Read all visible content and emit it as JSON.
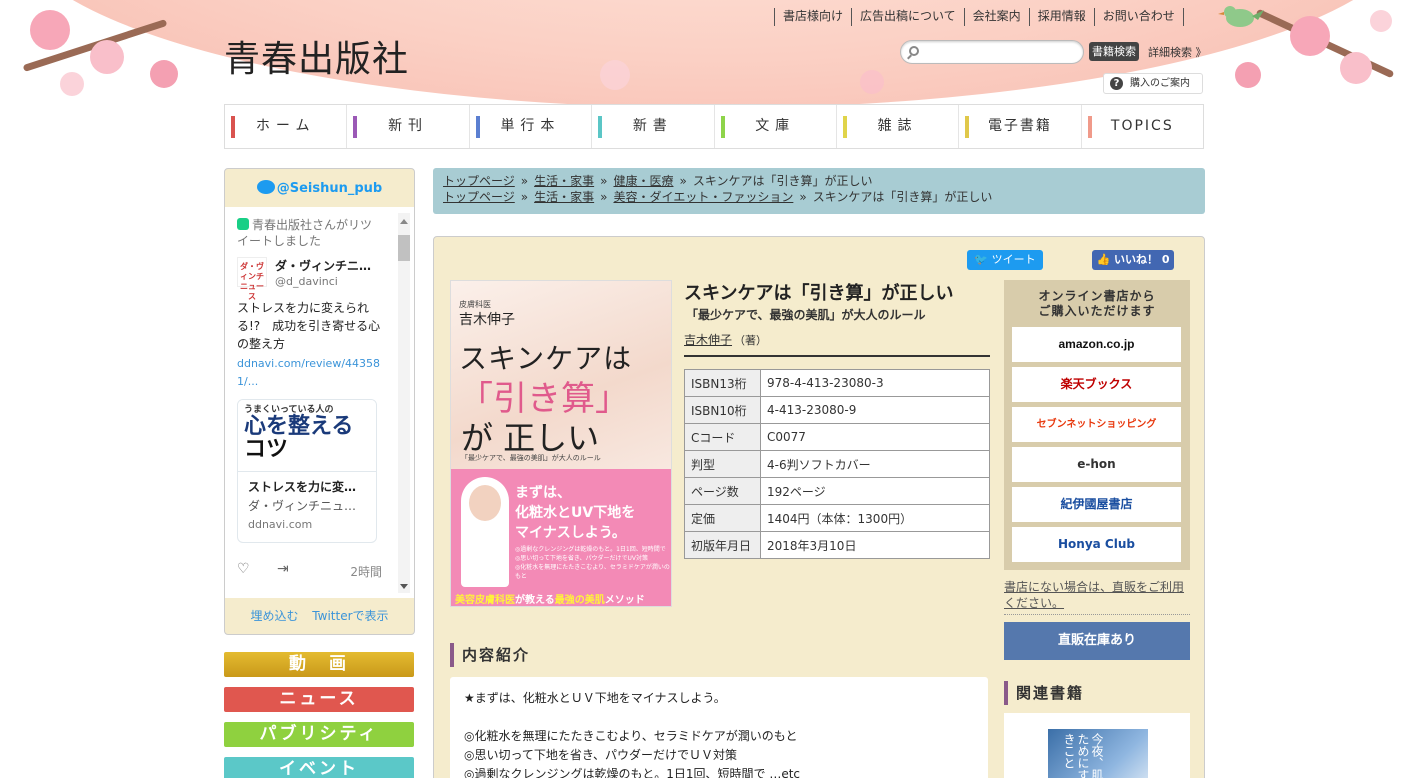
{
  "header": {
    "logo": "青春出版社",
    "top_links": [
      "書店様向け",
      "広告出稿について",
      "会社案内",
      "採用情報",
      "お問い合わせ"
    ],
    "search_placeholder": "",
    "search_button": "書籍検索",
    "advanced_search": "詳細検索 》",
    "purchase_guide": "購入のご案内"
  },
  "nav": {
    "items": [
      {
        "label": "ホーム",
        "color": "#d9534f"
      },
      {
        "label": "新刊",
        "color": "#9b59b6"
      },
      {
        "label": "単行本",
        "color": "#5b7fd1"
      },
      {
        "label": "新書",
        "color": "#5bc6c6"
      },
      {
        "label": "文庫",
        "color": "#8ed44a"
      },
      {
        "label": "雑誌",
        "color": "#e0d44a"
      },
      {
        "label": "電子書籍",
        "color": "#e0c84a"
      },
      {
        "label": "TOPICS",
        "color": "#f09a8a"
      }
    ]
  },
  "twitter": {
    "handle": "@Seishun_pub",
    "retweet_note": "青春出版社さんがリツイートしました",
    "avatar_text": "ダ・ヴィンチ ニュース",
    "name": "ダ・ヴィンチニ…",
    "user": "@d_davinci",
    "text": "ストレスを力に変えられる!?　成功を引き寄せる心の整え方",
    "link": "ddnavi.com/review/443581/...",
    "card_line1": "うまくいっている人の",
    "card_line2": "心を整える",
    "card_line3": "コツ",
    "card_title": "ストレスを力に変…",
    "card_sub": "ダ・ヴィンチニュ…",
    "card_domain": "ddnavi.com",
    "time": "2時間",
    "embed": "埋め込む",
    "view_on": "Twitterで表示"
  },
  "side_buttons": [
    {
      "label": "動　画",
      "color": "#d4a820"
    },
    {
      "label": "ニュース",
      "color": "#e0574f"
    },
    {
      "label": "パブリシティ",
      "color": "#8fd13f"
    },
    {
      "label": "イベント",
      "color": "#5bc8c8"
    }
  ],
  "breadcrumb": {
    "line1": [
      "トップページ",
      "生活・家事",
      "健康・医療"
    ],
    "line2": [
      "トップページ",
      "生活・家事",
      "美容・ダイエット・ファッション"
    ],
    "current": "スキンケアは「引き算」が正しい"
  },
  "share": {
    "tweet": "ツイート",
    "like": "いいね！ 0"
  },
  "cover": {
    "author_small": "皮膚科医",
    "author": "吉木伸子",
    "title1": "スキンケアは",
    "title2": "「引き算」",
    "title3": "が 正しい",
    "subtitle": "「最少ケアで、最強の美肌」が大人のルール",
    "msg1": "まずは、",
    "msg2": "化粧水とUV下地を",
    "msg3": "マイナスしよう。",
    "list1": "◎過剰なクレンジングは乾燥のもと。1日1回、短時間で",
    "list2": "◎思い切って下地を省き、パウダーだけでUV対策",
    "list3": "◎化粧水を無理にたたきこむより、セラミドケアが潤いのもと",
    "foot1": "美容皮膚科医",
    "foot2": "が教える",
    "foot3": "最強の美肌",
    "foot4": "メソッド"
  },
  "book": {
    "title": "スキンケアは「引き算」が正しい",
    "subtitle": "「最少ケアで、最強の美肌」が大人のルール",
    "author": "吉木伸子",
    "author_role": "（著）",
    "specs": [
      {
        "key": "ISBN13桁",
        "value": "978-4-413-23080-3"
      },
      {
        "key": "ISBN10桁",
        "value": "4-413-23080-9"
      },
      {
        "key": "Cコード",
        "value": "C0077"
      },
      {
        "key": "判型",
        "value": "4-6判ソフトカバー"
      },
      {
        "key": "ページ数",
        "value": "192ページ"
      },
      {
        "key": "定価",
        "value": "1404円（本体：1300円）"
      },
      {
        "key": "初版年月日",
        "value": "2018年3月10日"
      }
    ]
  },
  "online": {
    "title": "オンライン書店から\nご購入いただけます",
    "shops": [
      {
        "label": "amazon.co.jp",
        "color": "#111"
      },
      {
        "label": "楽天ブックス",
        "color": "#bf0000"
      },
      {
        "label": "セブンネットショッピング",
        "color": "#e8380d"
      },
      {
        "label": "e-hon",
        "color": "#333"
      },
      {
        "label": "紀伊國屋書店",
        "color": "#1a4ea0"
      },
      {
        "label": "Honya Club",
        "color": "#1a4ea0"
      }
    ],
    "direct_note": "書店にない場合は、直販をご利用ください。",
    "direct_button": "直販在庫あり"
  },
  "description": {
    "heading": "内容紹介",
    "lines": [
      "★まずは、化粧水とＵＶ下地をマイナスしよう。",
      "",
      "◎化粧水を無理にたたきこむより、セラミドケアが潤いのもと",
      "◎思い切って下地を省き、パウダーだけでＵＶ対策",
      "◎過剰なクレンジングは乾燥のもと。1日1回、短時間で …etc"
    ]
  },
  "related": {
    "heading": "関連書籍",
    "cover_text": "今夜、肌のためにすべきこと"
  }
}
